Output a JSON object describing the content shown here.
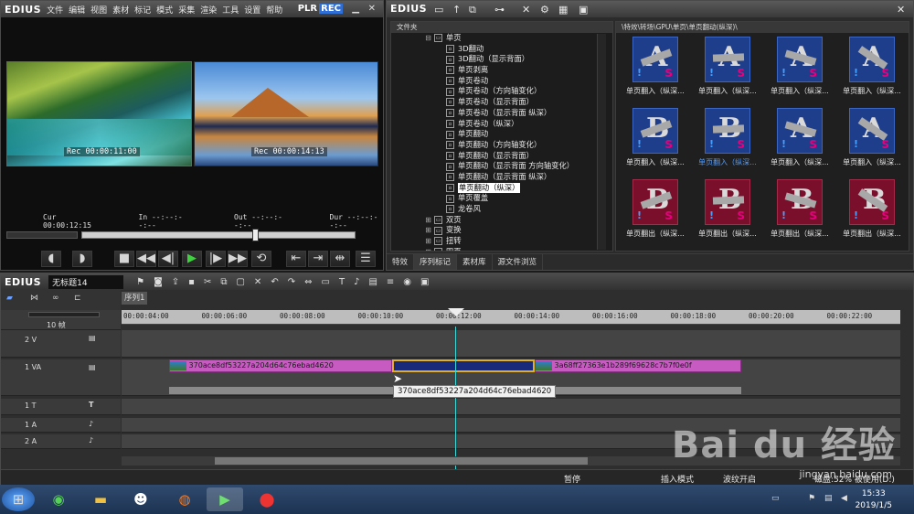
{
  "player": {
    "app_logo": "EDIUS",
    "menu": [
      "文件",
      "编辑",
      "视图",
      "素材",
      "标记",
      "模式",
      "采集",
      "渲染",
      "工具",
      "设置",
      "帮助"
    ],
    "plr_label": "PLR",
    "rec_label": "REC",
    "thumb1_timecode": "Rec 00:00:11:00",
    "thumb2_timecode": "Rec 00:00:14:13",
    "cur": "Cur 00:00:12:15",
    "in": "In --:--:--:--",
    "out": "Out --:--:--:--",
    "dur": "Dur --:--:--:--"
  },
  "effects": {
    "app_logo": "EDIUS",
    "tree_header": "文件夹",
    "tree_nodes": [
      {
        "label": "单页",
        "kind": "folder-open",
        "indent": 0
      },
      {
        "label": "3D翻动",
        "kind": "item",
        "indent": 1
      },
      {
        "label": "3D翻动（显示背面）",
        "kind": "item",
        "indent": 1
      },
      {
        "label": "单页剥离",
        "kind": "item",
        "indent": 1
      },
      {
        "label": "单页卷动",
        "kind": "item",
        "indent": 1
      },
      {
        "label": "单页卷动（方向轴变化）",
        "kind": "item",
        "indent": 1
      },
      {
        "label": "单页卷动（显示背面）",
        "kind": "item",
        "indent": 1
      },
      {
        "label": "单页卷动（显示背面 纵深）",
        "kind": "item",
        "indent": 1
      },
      {
        "label": "单页卷动（纵深）",
        "kind": "item",
        "indent": 1
      },
      {
        "label": "单页翻动",
        "kind": "item",
        "indent": 1
      },
      {
        "label": "单页翻动（方向轴变化）",
        "kind": "item",
        "indent": 1
      },
      {
        "label": "单页翻动（显示背面）",
        "kind": "item",
        "indent": 1
      },
      {
        "label": "单页翻动（显示背面 方向轴变化）",
        "kind": "item",
        "indent": 1
      },
      {
        "label": "单页翻动（显示背面 纵深）",
        "kind": "item",
        "indent": 1
      },
      {
        "label": "单页翻动（纵深）",
        "kind": "item",
        "indent": 1,
        "selected": true
      },
      {
        "label": "单页覆盖",
        "kind": "item",
        "indent": 1
      },
      {
        "label": "龙卷风",
        "kind": "item",
        "indent": 1
      },
      {
        "label": "双页",
        "kind": "folder",
        "indent": 0
      },
      {
        "label": "变换",
        "kind": "folder",
        "indent": 0
      },
      {
        "label": "扭转",
        "kind": "folder",
        "indent": 0
      },
      {
        "label": "四页",
        "kind": "folder",
        "indent": 0
      }
    ],
    "grid_path": "\\特效\\转场\\GPU\\单页\\单页翻动(纵深)\\",
    "grid_items": [
      {
        "caption": "单页翻入（纵深...",
        "letter": "A",
        "style": "blue",
        "highlight": false
      },
      {
        "caption": "单页翻入（纵深...",
        "letter": "A",
        "style": "blue",
        "highlight": false
      },
      {
        "caption": "单页翻入（纵深...",
        "letter": "A",
        "style": "blue",
        "highlight": false
      },
      {
        "caption": "单页翻入（纵深...",
        "letter": "A",
        "style": "blue",
        "highlight": false
      },
      {
        "caption": "单页翻入（纵深...",
        "letter": "B",
        "style": "blue",
        "highlight": false
      },
      {
        "caption": "单页翻入（纵深...",
        "letter": "B",
        "style": "blue",
        "highlight": true
      },
      {
        "caption": "单页翻入（纵深...",
        "letter": "A",
        "style": "blue",
        "highlight": false
      },
      {
        "caption": "单页翻入（纵深...",
        "letter": "A",
        "style": "blue",
        "highlight": false
      },
      {
        "caption": "单页翻出（纵深...",
        "letter": "B",
        "style": "red",
        "highlight": false
      },
      {
        "caption": "单页翻出（纵深...",
        "letter": "B",
        "style": "red",
        "highlight": false
      },
      {
        "caption": "单页翻出（纵深...",
        "letter": "B",
        "style": "red",
        "highlight": false
      },
      {
        "caption": "单页翻出（纵深...",
        "letter": "B",
        "style": "red",
        "highlight": false
      }
    ],
    "tabs": [
      "特效",
      "序列标记",
      "素材库",
      "源文件浏览"
    ]
  },
  "timeline": {
    "app_logo": "EDIUS",
    "project_name": "无标题14",
    "sequence_tab": "序列1",
    "zoom_label": "10 帧",
    "ruler_ticks": [
      "00:00:04:00",
      "00:00:06:00",
      "00:00:08:00",
      "00:00:10:00",
      "00:00:12:00",
      "00:00:14:00",
      "00:00:16:00",
      "00:00:18:00",
      "00:00:20:00",
      "00:00:22:00"
    ],
    "tracks": [
      "2 V",
      "1 VA",
      "1 T",
      "1 A",
      "2 A"
    ],
    "clip1": "370ace8df53227a204d64c76ebad4620",
    "clip2": "3a68ff27363e1b289f69628c7b7f0e0f",
    "tooltip": "370ace8df53227a204d64c76ebad4620",
    "status_pause": "暂停",
    "status_insert": "插入模式",
    "status_ripple": "波纹开启",
    "status_disk": "磁盘:52% 被使用(D:)"
  },
  "taskbar": {
    "time": "15:33",
    "date": "2019/1/5"
  },
  "watermark": {
    "brand": "Bai du 经验",
    "url": "jingyan.baidu.com"
  },
  "colors": {
    "accent": "#2f6fd8",
    "clip": "#c75bc2",
    "playhead": "#38d6d6"
  }
}
